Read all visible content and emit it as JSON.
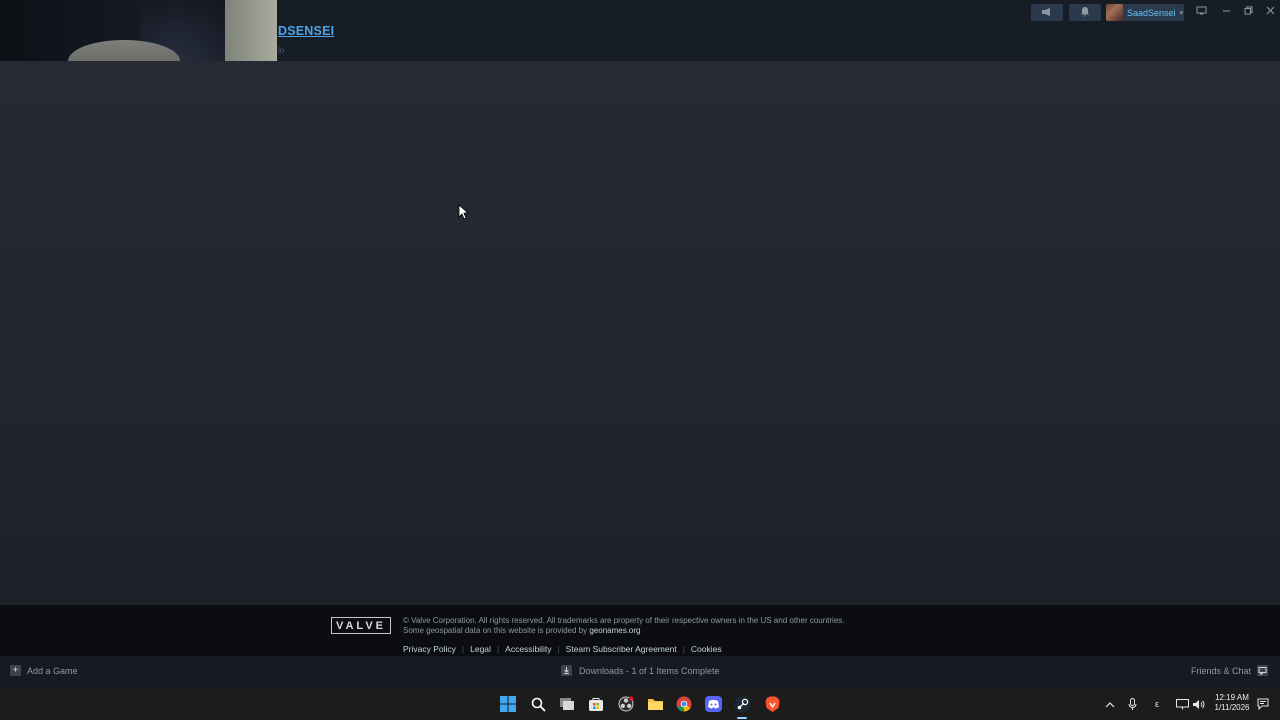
{
  "header": {
    "profile_name": "DSENSEI",
    "profile_sub": "lo",
    "user_menu": {
      "name": "SaadSensei"
    }
  },
  "webcam": {
    "description_icon": "webcam-overlay"
  },
  "footer": {
    "logo_text": "VALVE",
    "copyright_line1": "© Valve Corporation. All rights reserved. All trademarks are property of their respective owners in the US and other countries.",
    "copyright_line2_prefix": "Some geospatial data on this website is provided by ",
    "copyright_line2_link": "geonames.org",
    "links": [
      "Privacy Policy",
      "Legal",
      "Accessibility",
      "Steam Subscriber Agreement",
      "Cookies"
    ]
  },
  "steam_bar": {
    "add_game": "Add a Game",
    "downloads": "Downloads - 1 of 1 Items Complete",
    "friends_chat": "Friends & Chat"
  },
  "taskbar": {
    "icons": [
      "windows-start-icon",
      "search-icon",
      "task-view-icon",
      "store-icon",
      "obs-icon",
      "file-explorer-icon",
      "chrome-icon",
      "discord-icon",
      "steam-icon",
      "brave-icon"
    ],
    "tray": {
      "language": "ε"
    },
    "clock": {
      "time": "12:19 AM",
      "date": "1/11/2026"
    }
  },
  "colors": {
    "accent": "#67c1f5",
    "profile_link": "#4fa3e8",
    "background": "#1b2838"
  }
}
